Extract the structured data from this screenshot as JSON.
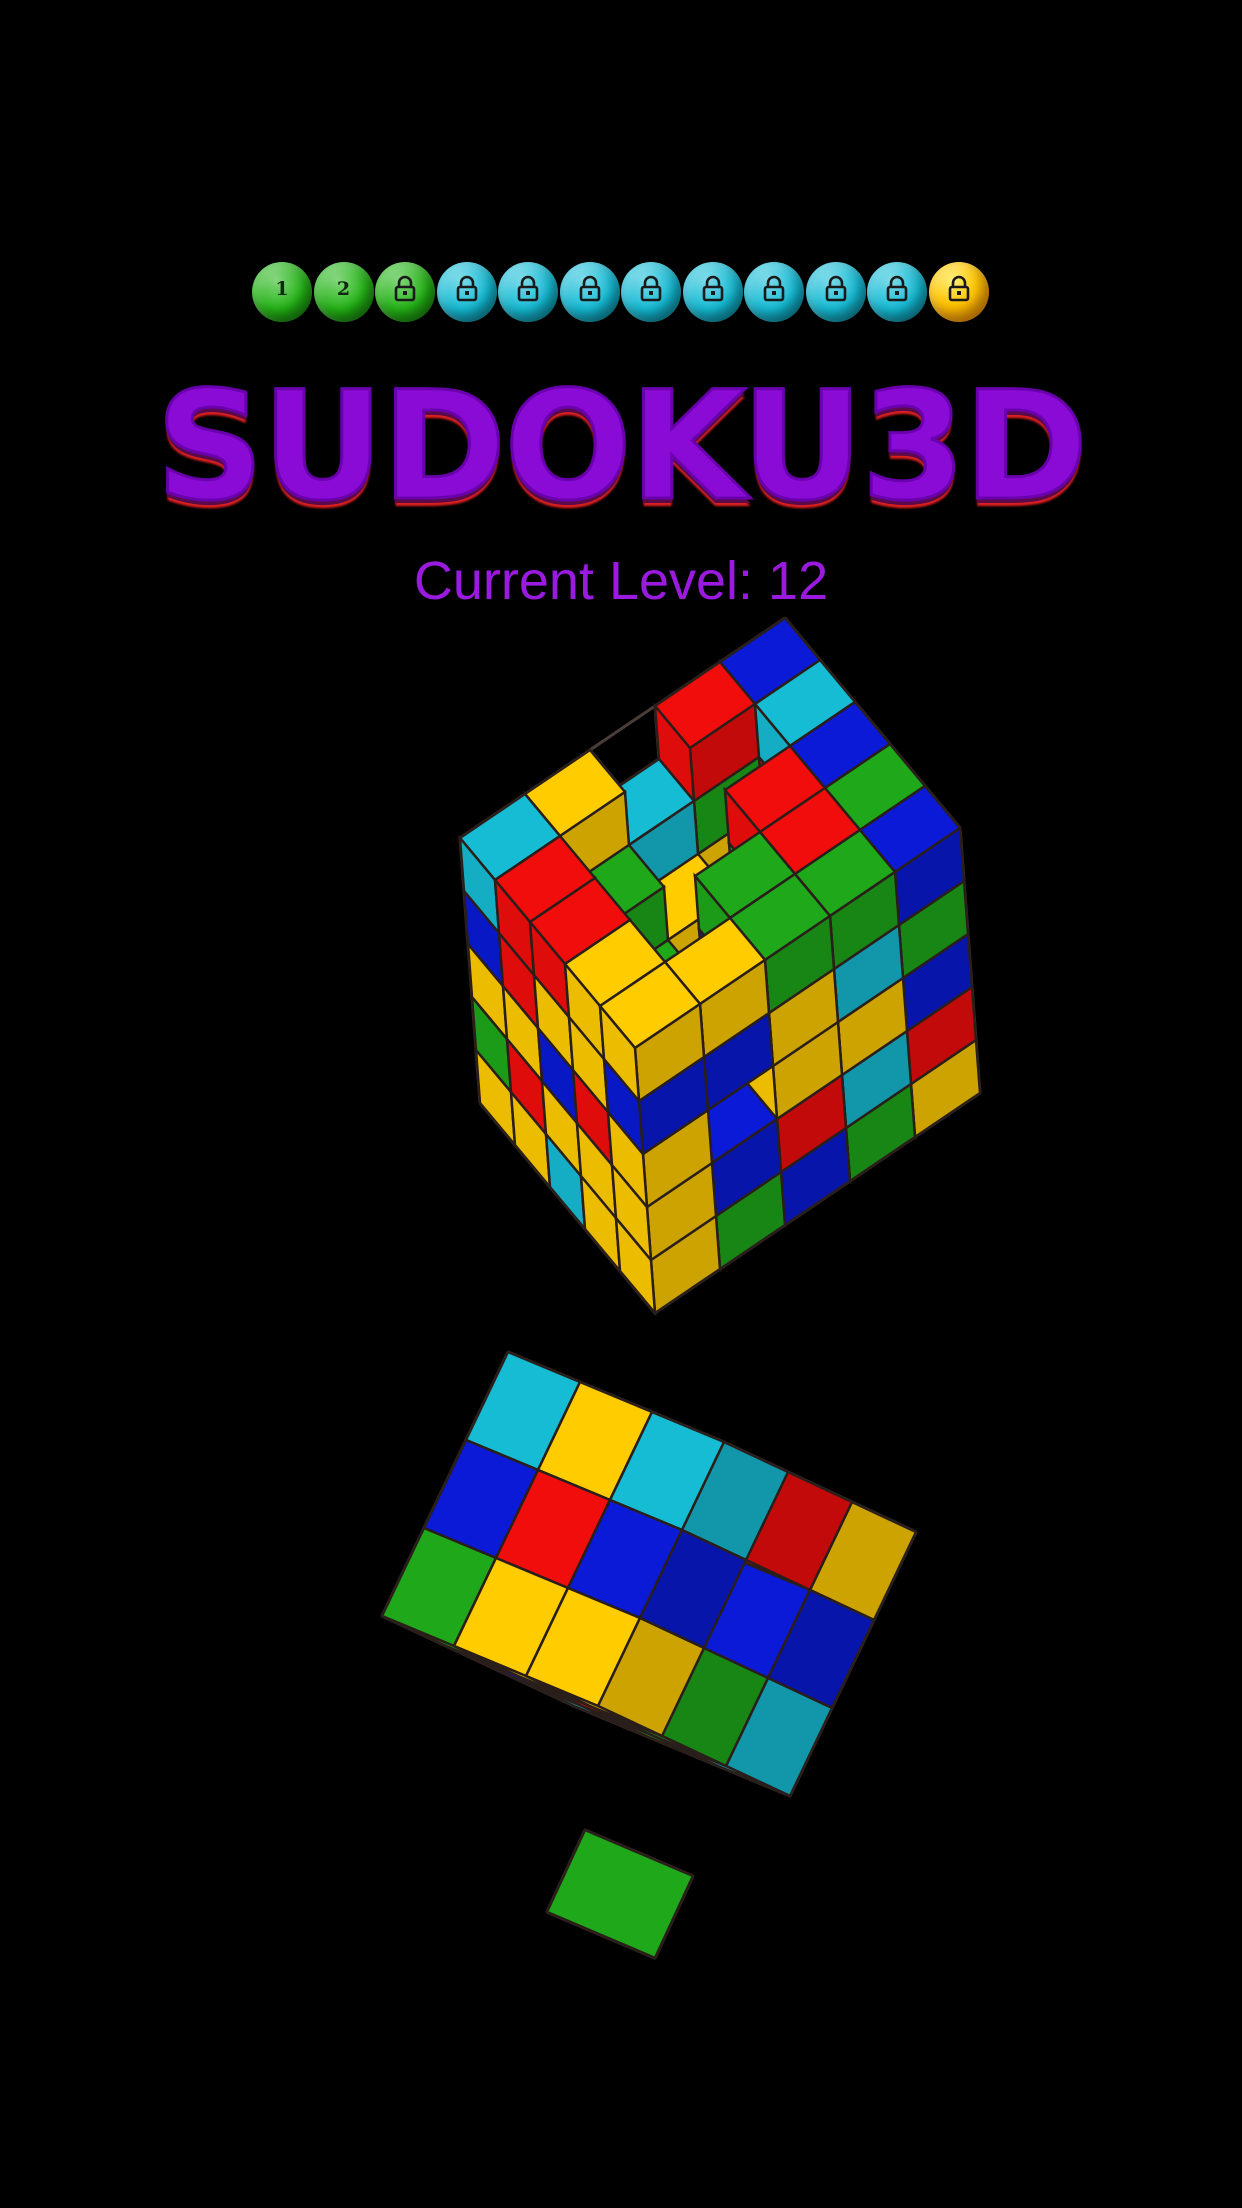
{
  "levels": [
    {
      "label": "1",
      "state": "completed",
      "color": "#22b414"
    },
    {
      "label": "2",
      "state": "completed",
      "color": "#22b414"
    },
    {
      "label": "",
      "state": "unlocked",
      "color": "#22b414"
    },
    {
      "label": "",
      "state": "locked",
      "color": "#13bcd6"
    },
    {
      "label": "",
      "state": "locked",
      "color": "#13bcd6"
    },
    {
      "label": "",
      "state": "locked",
      "color": "#13bcd6"
    },
    {
      "label": "",
      "state": "locked",
      "color": "#13bcd6"
    },
    {
      "label": "",
      "state": "locked",
      "color": "#13bcd6"
    },
    {
      "label": "",
      "state": "locked",
      "color": "#13bcd6"
    },
    {
      "label": "",
      "state": "locked",
      "color": "#13bcd6"
    },
    {
      "label": "",
      "state": "locked",
      "color": "#13bcd6"
    },
    {
      "label": "",
      "state": "current",
      "color": "#ffc400"
    }
  ],
  "title": "SUDOKU3D",
  "current_level_text": "Current Level: 12",
  "colors": {
    "background": "#000000",
    "title": "#8a0bd6",
    "subtitle": "#9a1ae0",
    "cube_red": "#f20d0d",
    "cube_yellow": "#ffcc00",
    "cube_blue": "#0a1ad6",
    "cube_green": "#1ea81a",
    "cube_cyan": "#16bcd4",
    "wireframe": "#4a3c38"
  },
  "cubes": [
    {
      "name": "large-cube",
      "size": 5
    },
    {
      "name": "medium-cube",
      "size": 3
    },
    {
      "name": "small-cube",
      "size": 1
    }
  ]
}
